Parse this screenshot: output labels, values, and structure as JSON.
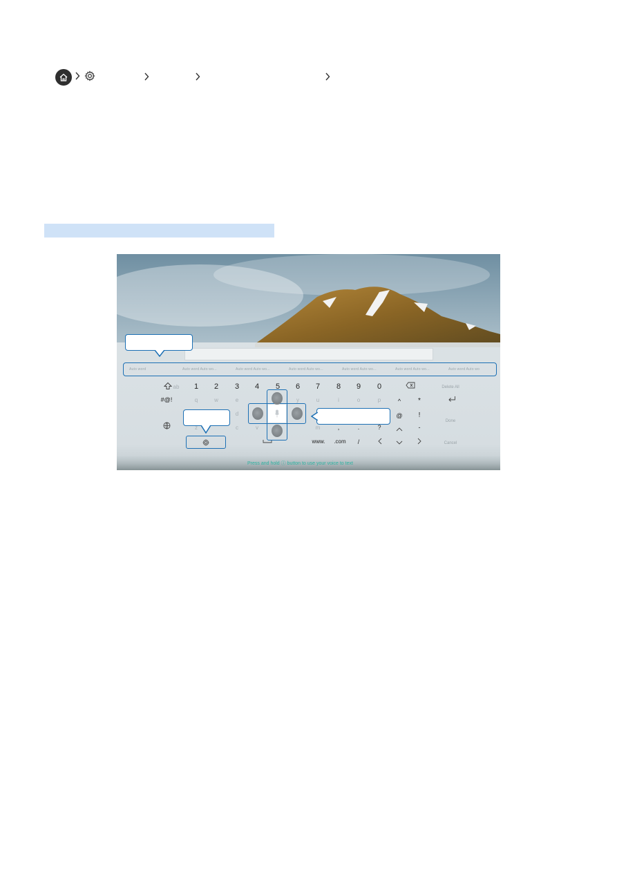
{
  "breadcrumb": {
    "icons": [
      "home-icon",
      "chevron-right-icon",
      "gear-icon",
      "chevron-right-icon",
      "chevron-right-icon",
      "chevron-right-icon"
    ]
  },
  "colors": {
    "highlight": "#cfe2f7",
    "callout_border": "#1b6fb4",
    "status_text": "#2fb3a2"
  },
  "keyboard": {
    "suggestions": [
      "Auto word",
      "Auto word Auto wo...",
      "Auto word Auto wo...",
      "Auto word Auto wo...",
      "Auto word Auto wo...",
      "Auto word Auto wo...",
      "Auto word Auto wo"
    ],
    "number_row": [
      "1",
      "2",
      "3",
      "4",
      "5",
      "6",
      "7",
      "8",
      "9",
      "0"
    ],
    "row2": [
      "q",
      "w",
      "e",
      "r",
      "t",
      "y",
      "u",
      "i",
      "o",
      "p",
      "^",
      "*"
    ],
    "row3": [
      "a",
      "s",
      "d",
      "f",
      "g",
      "h",
      "j",
      "k",
      "l",
      "@",
      "!"
    ],
    "row4": [
      "z",
      "x",
      "c",
      "v",
      "b",
      "n",
      "m",
      ",",
      ".",
      "?",
      "^",
      "-"
    ],
    "bottom_row": [
      "www.",
      ".com",
      "/",
      "<",
      "v",
      ">"
    ],
    "special": {
      "shift_hint": "ab",
      "symbols": "#@!",
      "delete_all": "Delete All",
      "done": "Done",
      "cancel": "Cancel"
    },
    "status": "Press and hold ⓘ button to use your voice to text"
  }
}
